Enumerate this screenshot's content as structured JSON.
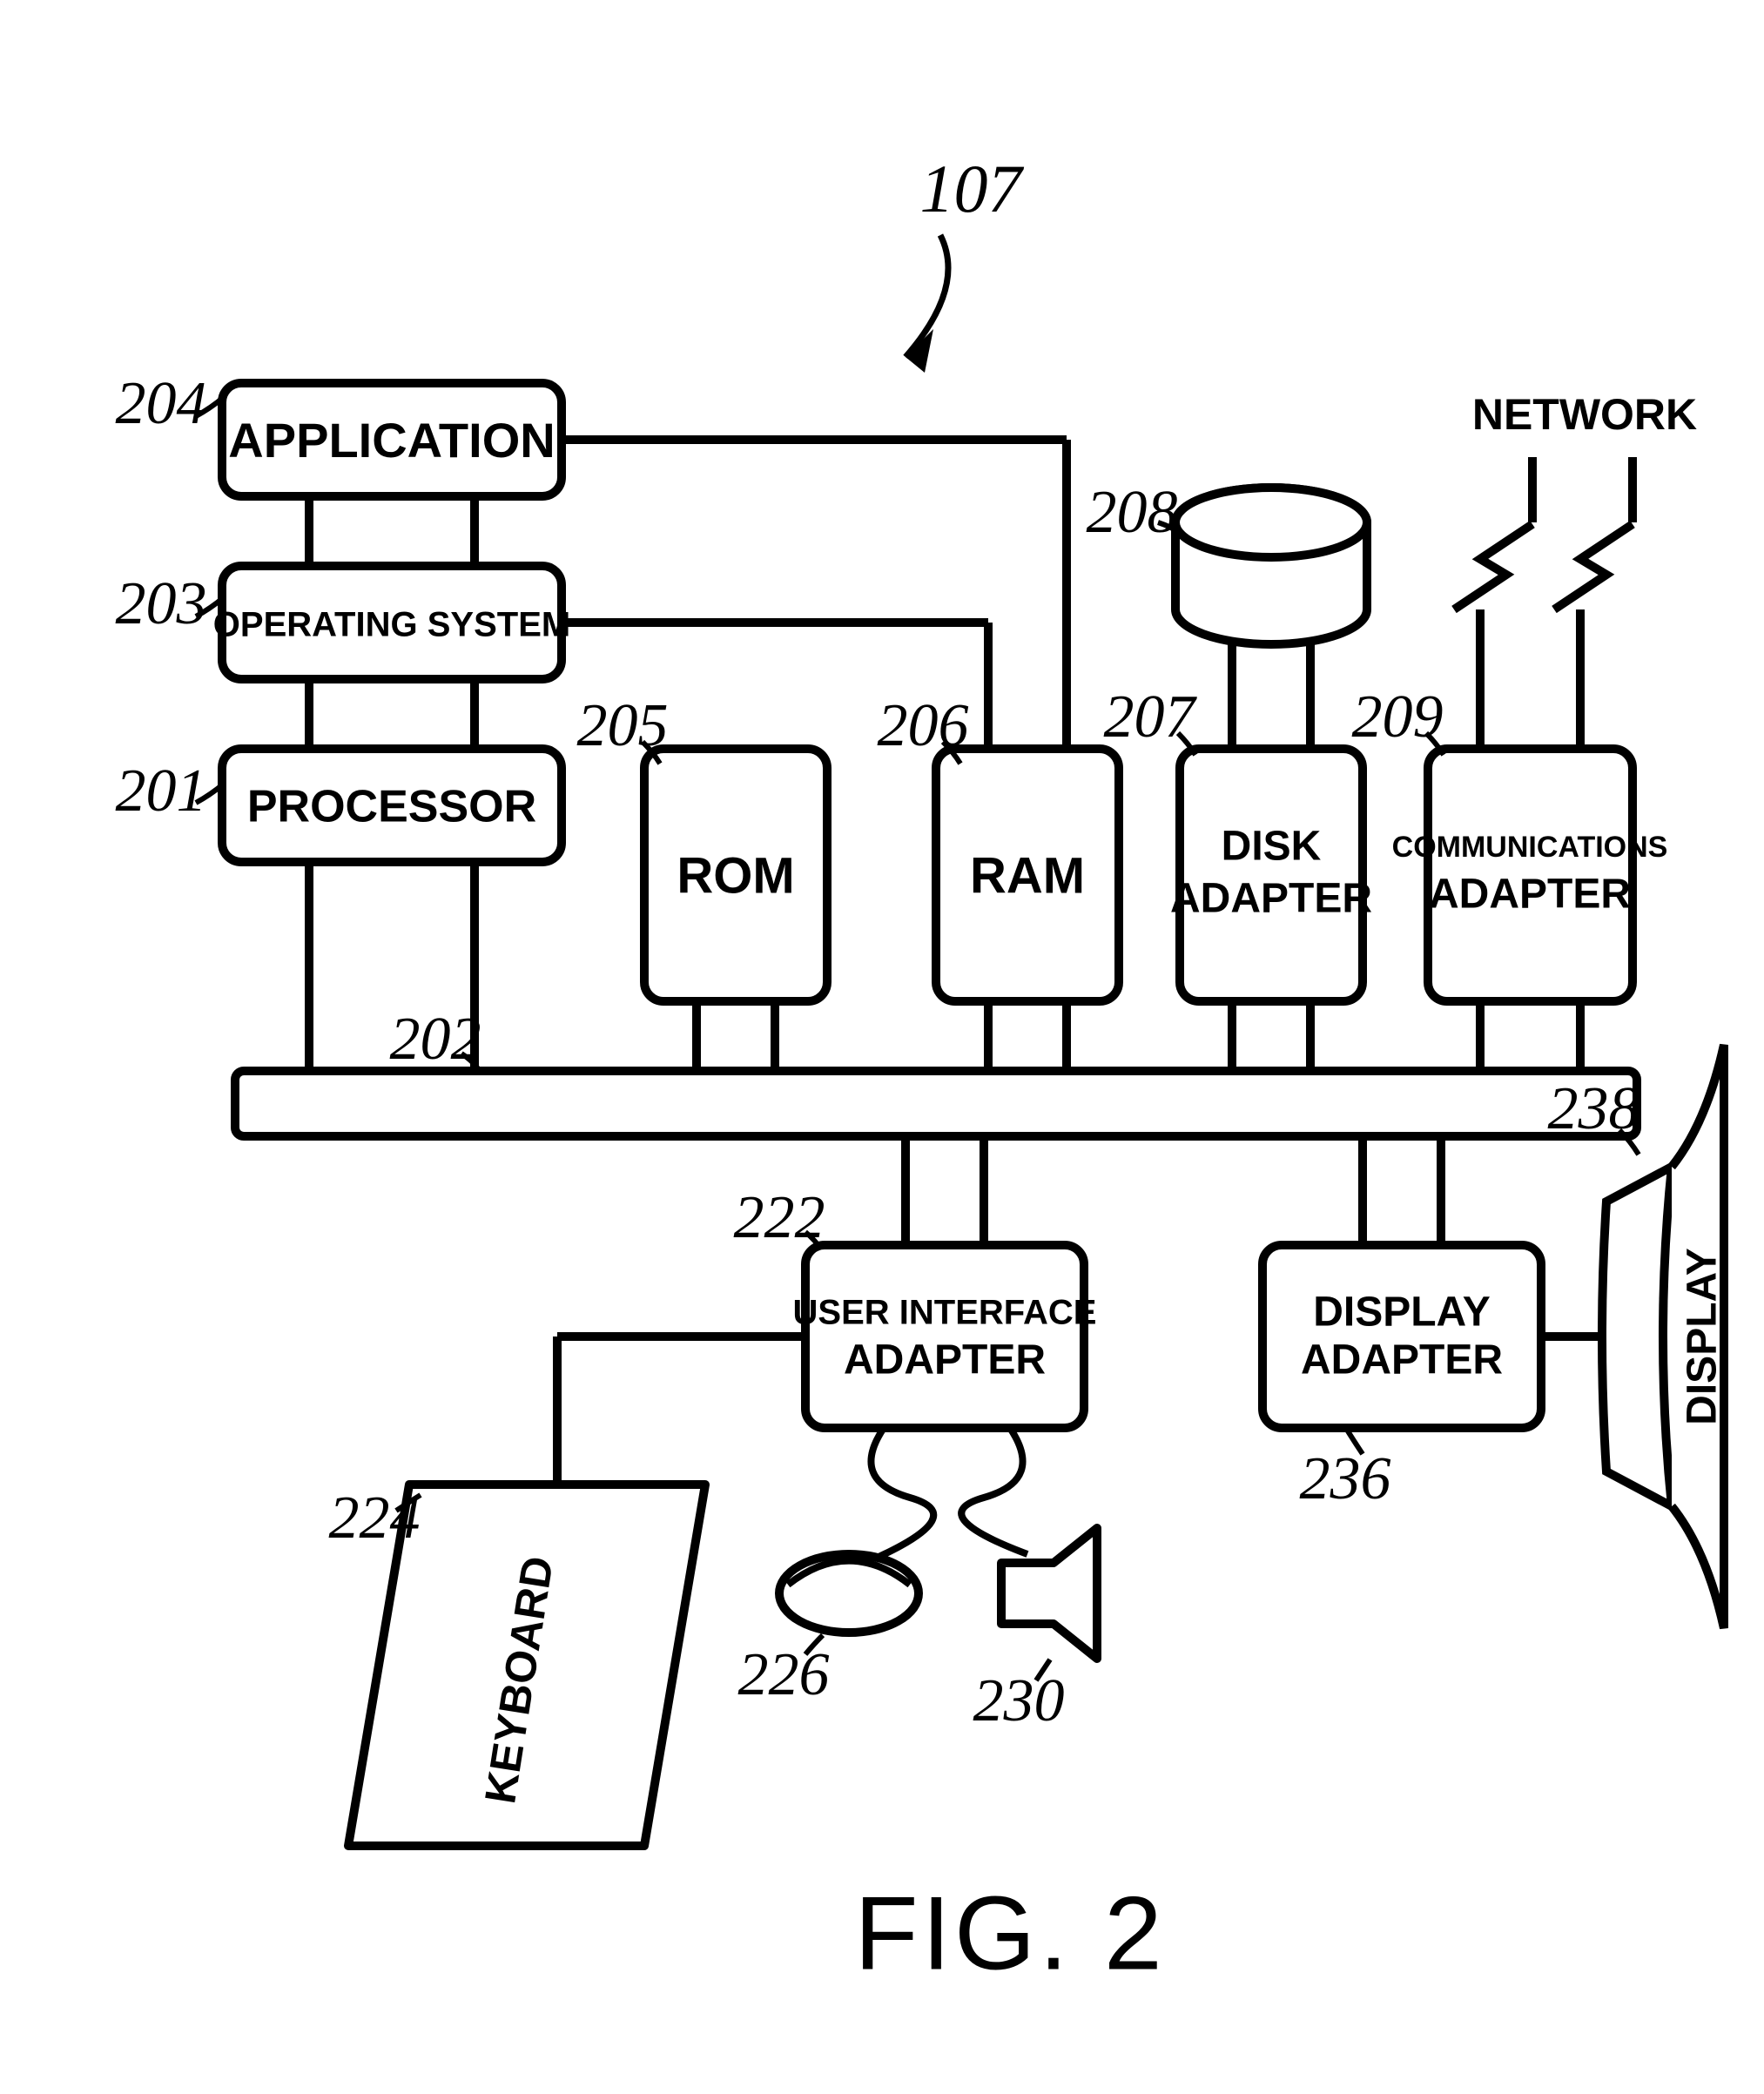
{
  "figure_ref": "107",
  "figure_label": "FIG. 2",
  "blocks": {
    "application": {
      "label": "APPLICATION",
      "ref": "204"
    },
    "operating_system": {
      "label": "OPERATING SYSTEM",
      "ref": "203"
    },
    "processor": {
      "label": "PROCESSOR",
      "ref": "201"
    },
    "rom": {
      "label": "ROM",
      "ref": "205"
    },
    "ram": {
      "label": "RAM",
      "ref": "206"
    },
    "disk_adapter": {
      "label": "DISK ADAPTER",
      "ref": "207"
    },
    "disk": {
      "label": "",
      "ref": "208"
    },
    "comm_adapter": {
      "label": "COMMUNICATIONS ADAPTER",
      "ref": "209"
    },
    "network": {
      "label": "NETWORK",
      "ref": ""
    },
    "bus": {
      "label": "",
      "ref": "202"
    },
    "user_if_adapter": {
      "label": "USER INTERFACE ADAPTER",
      "ref": "222"
    },
    "keyboard": {
      "label": "KEYBOARD",
      "ref": "224"
    },
    "mouse": {
      "label": "",
      "ref": "226"
    },
    "speaker": {
      "label": "",
      "ref": "230"
    },
    "display_adapter": {
      "label": "DISPLAY ADAPTER",
      "ref": "236"
    },
    "display": {
      "label": "DISPLAY",
      "ref": "238"
    }
  }
}
